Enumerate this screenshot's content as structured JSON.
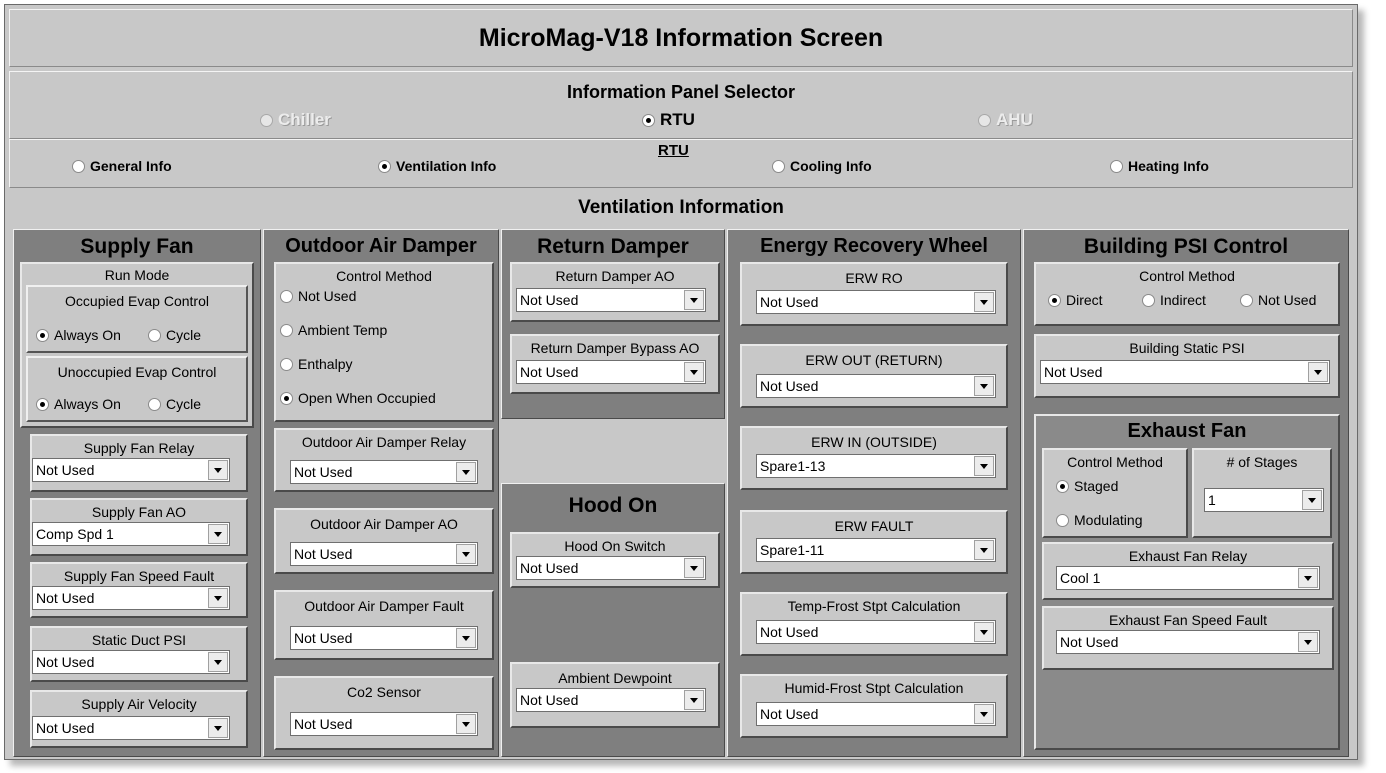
{
  "title": "MicroMag-V18 Information Screen",
  "selector": {
    "heading": "Information Panel Selector",
    "chiller": "Chiller",
    "rtu": "RTU",
    "ahu": "AHU",
    "sub_heading": "RTU",
    "general": "General Info",
    "ventilation": "Ventilation Info",
    "cooling": "Cooling Info",
    "heating": "Heating Info"
  },
  "ventilation_heading": "Ventilation Information",
  "supply_fan": {
    "title": "Supply Fan",
    "run_mode": "Run Mode",
    "occupied": "Occupied Evap Control",
    "unoccupied": "Unoccupied Evap Control",
    "always_on": "Always On",
    "cycle": "Cycle",
    "relay_label": "Supply Fan Relay",
    "relay_value": "Not Used",
    "ao_label": "Supply Fan AO",
    "ao_value": "Comp Spd 1",
    "speed_fault_label": "Supply Fan Speed Fault",
    "speed_fault_value": "Not Used",
    "static_label": "Static Duct PSI",
    "static_value": "Not Used",
    "velocity_label": "Supply Air Velocity",
    "velocity_value": "Not Used"
  },
  "oad": {
    "title": "Outdoor Air Damper",
    "control_method": "Control Method",
    "opt_not_used": "Not Used",
    "opt_ambient": "Ambient Temp",
    "opt_enthalpy": "Enthalpy",
    "opt_open": "Open When Occupied",
    "relay_label": "Outdoor Air Damper Relay",
    "relay_value": "Not Used",
    "ao_label": "Outdoor Air Damper AO",
    "ao_value": "Not Used",
    "fault_label": "Outdoor Air Damper Fault",
    "fault_value": "Not Used",
    "co2_label": "Co2 Sensor",
    "co2_value": "Not Used"
  },
  "return_damper": {
    "title": "Return Damper",
    "ao_label": "Return Damper AO",
    "ao_value": "Not Used",
    "bypass_label": "Return Damper Bypass AO",
    "bypass_value": "Not Used"
  },
  "hood": {
    "title": "Hood On",
    "switch_label": "Hood On Switch",
    "switch_value": "Not Used",
    "dew_label": "Ambient Dewpoint",
    "dew_value": "Not Used"
  },
  "erw": {
    "title": "Energy Recovery Wheel",
    "ro_label": "ERW RO",
    "ro_value": "Not Used",
    "out_label": "ERW OUT (RETURN)",
    "out_value": "Not Used",
    "in_label": "ERW IN (OUTSIDE)",
    "in_value": "Spare1-13",
    "fault_label": "ERW FAULT",
    "fault_value": "Spare1-11",
    "temp_label": "Temp-Frost Stpt Calculation",
    "temp_value": "Not Used",
    "humid_label": "Humid-Frost Stpt Calculation",
    "humid_value": "Not Used"
  },
  "bpsi": {
    "title": "Building PSI Control",
    "control_method": "Control Method",
    "direct": "Direct",
    "indirect": "Indirect",
    "not_used": "Not Used",
    "static_label": "Building Static PSI",
    "static_value": "Not Used"
  },
  "exhaust": {
    "title": "Exhaust Fan",
    "control_method": "Control Method",
    "staged": "Staged",
    "modulating": "Modulating",
    "stages_label": "# of Stages",
    "stages_value": "1",
    "relay_label": "Exhaust Fan Relay",
    "relay_value": "Cool 1",
    "speed_fault_label": "Exhaust Fan Speed Fault",
    "speed_fault_value": "Not Used"
  }
}
